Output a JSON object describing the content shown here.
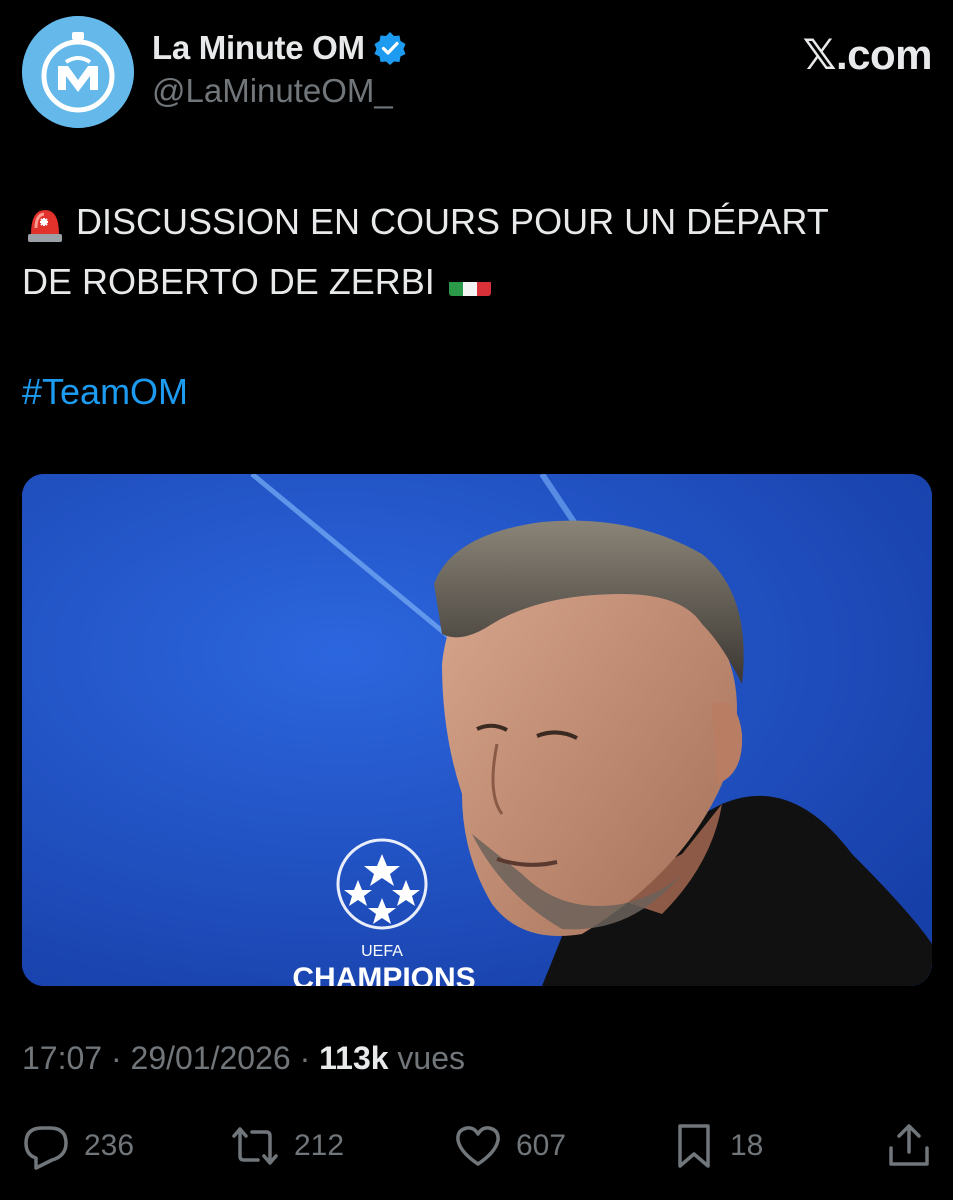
{
  "brand": {
    "label": ".com"
  },
  "account": {
    "display_name": "La Minute OM",
    "handle": "@LaMinuteOM_",
    "verified": true,
    "avatar_color": "#64b8ea"
  },
  "tweet": {
    "line1": "DISCUSSION EN COURS POUR UN DÉPART",
    "line2": "DE ROBERTO DE ZERBI",
    "hashtag": "#TeamOM",
    "hashtag_color": "#1d9bf0"
  },
  "media": {
    "logo_text": "CHAMPIONS",
    "logo_small": "UEFA"
  },
  "meta": {
    "time": "17:07",
    "separator": "·",
    "date": "29/01/2026",
    "views_count": "113k",
    "views_label": "vues"
  },
  "actions": {
    "replies": "236",
    "reposts": "212",
    "likes": "607",
    "bookmarks": "18"
  },
  "icons": {
    "siren": "police-light-emoji",
    "flag": "italy-flag-emoji",
    "verified": "verified-badge-icon",
    "reply": "reply-icon",
    "repost": "repost-icon",
    "like": "heart-icon",
    "bookmark": "bookmark-icon",
    "share": "share-icon"
  }
}
